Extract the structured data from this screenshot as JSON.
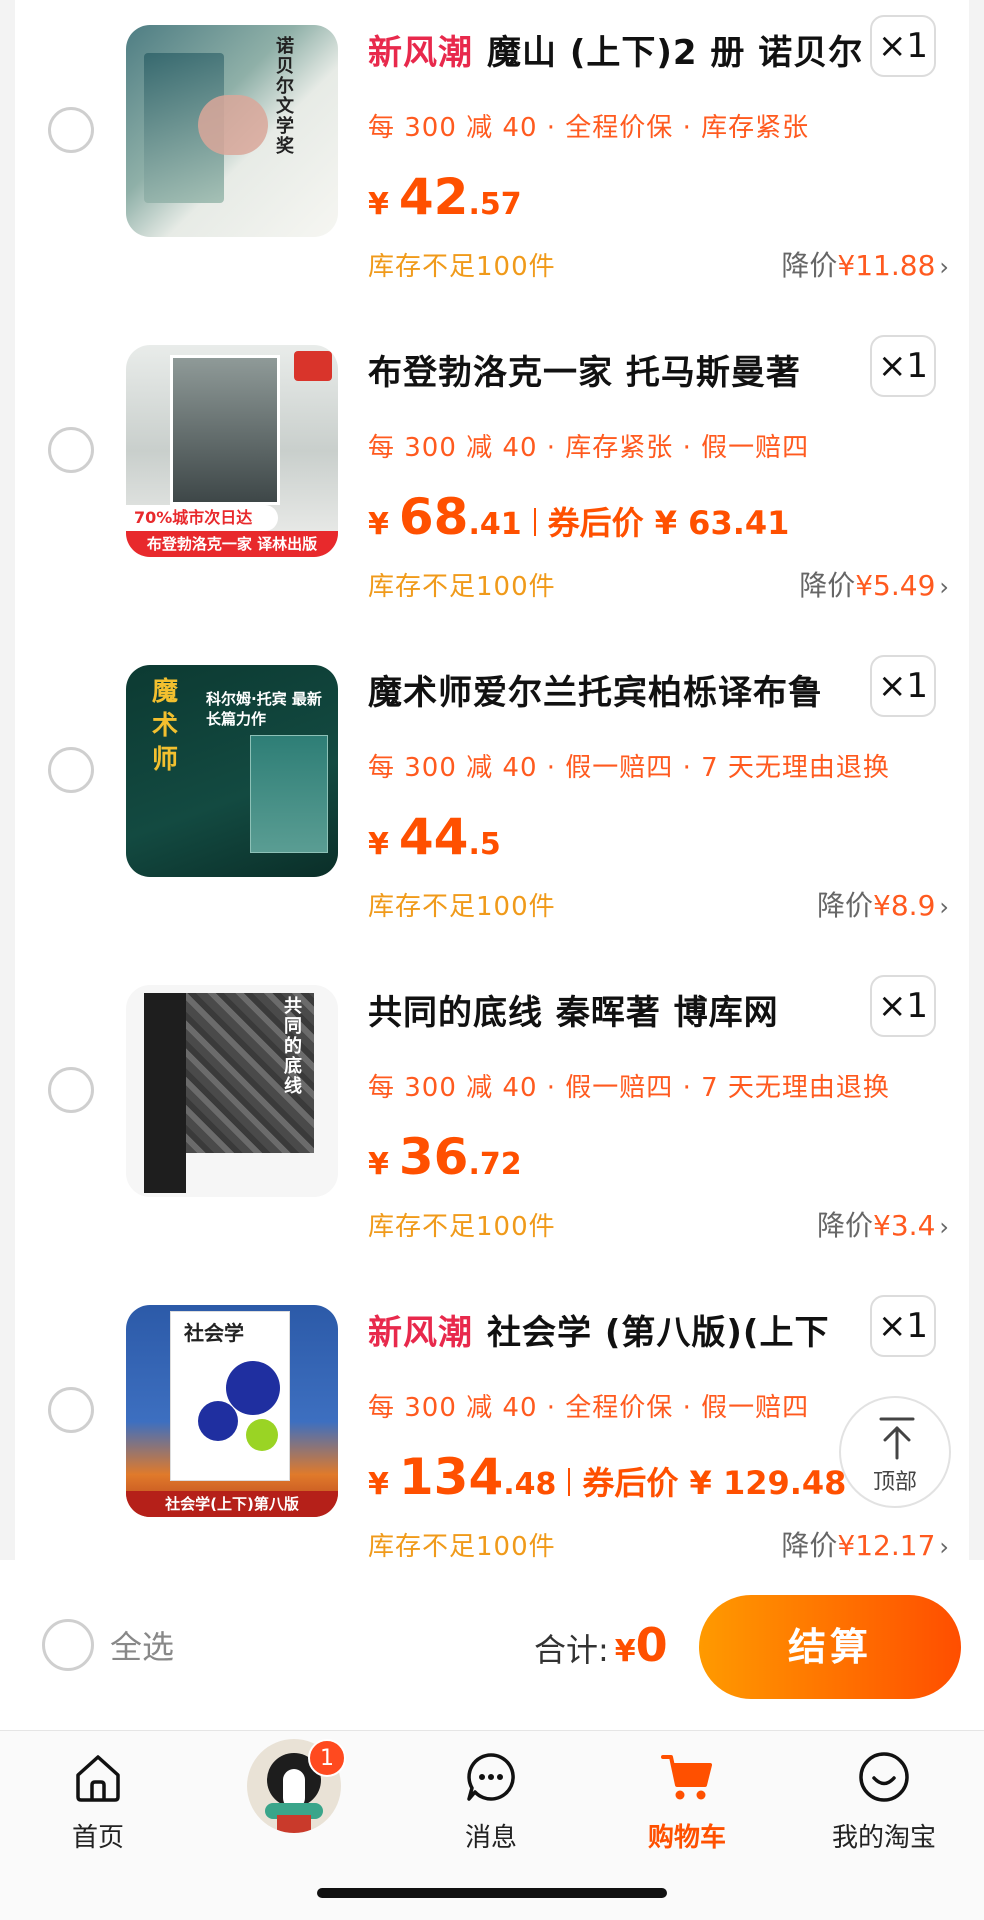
{
  "items": [
    {
      "tag": "新风潮",
      "title": "魔山 (上下)2 册 诺贝尔",
      "qty": "×1",
      "promos": "每 300 减 40 · 全程价保 · 库存紧张",
      "price_yen": "¥",
      "price_int": "42",
      "price_dec": ".57",
      "coupon_label": "",
      "coupon_price": "",
      "stock_note": "库存不足100件",
      "drop_label": "降价",
      "drop_amount": "¥11.88",
      "cover_colors": [
        "#6f8f92",
        "#c9d3cf"
      ],
      "cover_text": "诺贝尔文学奖"
    },
    {
      "tag": "",
      "title": "布登勃洛克一家 托马斯曼著",
      "qty": "×1",
      "promos": "每 300 减 40 · 库存紧张 · 假一赔四",
      "price_yen": "¥",
      "price_int": "68",
      "price_dec": ".41",
      "coupon_label": "券后价 ¥ 63.41",
      "coupon_price": "",
      "stock_note": "库存不足100件",
      "drop_label": "降价",
      "drop_amount": "¥5.49",
      "cover_colors": [
        "#566063",
        "#e8eae8"
      ],
      "cover_text": "70%城市次日达",
      "cover_subtext": "布登勃洛克一家 译林出版"
    },
    {
      "tag": "",
      "title": "魔术师爱尔兰托宾柏栎译布鲁",
      "qty": "×1",
      "promos": "每 300 减 40 · 假一赔四 · 7 天无理由退换",
      "price_yen": "¥",
      "price_int": "44",
      "price_dec": ".5",
      "coupon_label": "",
      "coupon_price": "",
      "stock_note": "库存不足100件",
      "drop_label": "降价",
      "drop_amount": "¥8.9",
      "cover_colors": [
        "#0f3e36",
        "#2a6b5f"
      ],
      "cover_text": "魔术师",
      "cover_subtext": "科尔姆·托宾 最新长篇力作"
    },
    {
      "tag": "",
      "title": "共同的底线 秦晖著 博库网",
      "qty": "×1",
      "promos": "每 300 减 40 · 假一赔四 · 7 天无理由退换",
      "price_yen": "¥",
      "price_int": "36",
      "price_dec": ".72",
      "coupon_label": "",
      "coupon_price": "",
      "stock_note": "库存不足100件",
      "drop_label": "降价",
      "drop_amount": "¥3.4",
      "cover_colors": [
        "#2b2b2b",
        "#f2f2f2"
      ],
      "cover_text": "共同的底线"
    },
    {
      "tag": "新风潮",
      "title": "社会学 (第八版)(上下",
      "qty": "×1",
      "promos": "每 300 减 40 · 全程价保 · 假一赔四",
      "price_yen": "¥",
      "price_int": "134",
      "price_dec": ".48",
      "coupon_label": "券后价 ¥ 129.48",
      "coupon_price": "",
      "stock_note": "库存不足100件",
      "drop_label": "降价",
      "drop_amount": "¥12.17",
      "cover_colors": [
        "#2453a8",
        "#f5c242"
      ],
      "cover_text": "社会学",
      "cover_subtext": "社会学(上下)第八版"
    }
  ],
  "scroll_top_label": "顶部",
  "checkout": {
    "select_all": "全选",
    "total_label": "合计:",
    "total_yen": "¥",
    "total_amount": "0",
    "checkout_label": "结算"
  },
  "tabbar": {
    "home": "首页",
    "badge": "1",
    "messages": "消息",
    "cart": "购物车",
    "mine": "我的淘宝"
  },
  "colors": {
    "accent": "#ff5000",
    "tag": "#e8294c",
    "stock": "#f09a1a"
  }
}
